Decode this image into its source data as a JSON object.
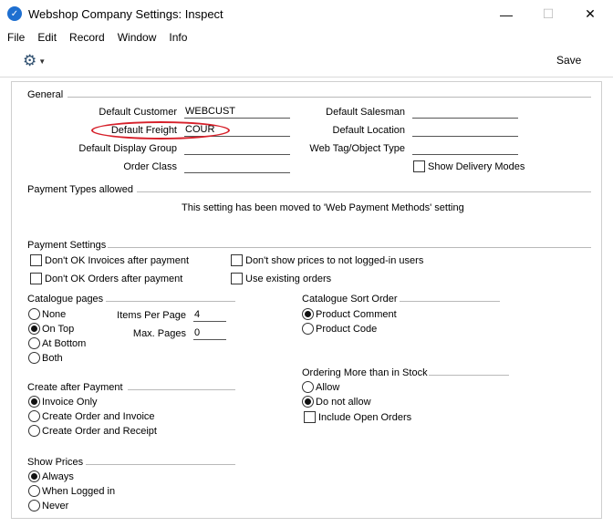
{
  "window": {
    "title": "Webshop Company Settings: Inspect",
    "app_icon_glyph": "✓"
  },
  "menu": [
    "File",
    "Edit",
    "Record",
    "Window",
    "Info"
  ],
  "toolbar": {
    "save_label": "Save",
    "gear_icon": "gear-icon"
  },
  "general": {
    "title": "General",
    "default_customer_label": "Default Customer",
    "default_customer_value": "WEBCUST",
    "default_freight_label": "Default Freight",
    "default_freight_value": "COUR",
    "default_display_group_label": "Default Display Group",
    "default_display_group_value": "",
    "order_class_label": "Order Class",
    "order_class_value": "",
    "default_salesman_label": "Default Salesman",
    "default_salesman_value": "",
    "default_location_label": "Default Location",
    "default_location_value": "",
    "web_tag_label": "Web Tag/Object Type",
    "web_tag_value": "",
    "show_delivery_modes_label": "Show Delivery Modes",
    "show_delivery_modes_checked": false
  },
  "payment_types": {
    "title": "Payment Types allowed",
    "message": "This setting has been moved to 'Web Payment Methods' setting"
  },
  "payment_settings": {
    "title": "Payment Settings",
    "dont_ok_invoices": "Don't OK Invoices after payment",
    "dont_ok_orders": "Don't OK Orders after payment",
    "dont_show_prices": "Don't show prices to not logged-in users",
    "use_existing_orders": "Use existing orders"
  },
  "catalogue_pages": {
    "title": "Catalogue pages",
    "options": [
      "None",
      "On Top",
      "At Bottom",
      "Both"
    ],
    "selected": "On Top",
    "items_per_page_label": "Items Per Page",
    "items_per_page_value": "4",
    "max_pages_label": "Max. Pages",
    "max_pages_value": "0"
  },
  "catalogue_sort": {
    "title": "Catalogue Sort Order",
    "options": [
      "Product Comment",
      "Product Code"
    ],
    "selected": "Product Comment"
  },
  "create_after_payment": {
    "title": "Create after Payment",
    "options": [
      "Invoice Only",
      "Create Order and Invoice",
      "Create Order and Receipt"
    ],
    "selected": "Invoice Only"
  },
  "ordering_more": {
    "title": "Ordering More than in Stock",
    "options": [
      "Allow",
      "Do not allow"
    ],
    "selected": "Do not allow",
    "include_open_orders_label": "Include Open Orders"
  },
  "show_prices": {
    "title": "Show Prices",
    "options": [
      "Always",
      "When Logged in",
      "Never"
    ],
    "selected": "Always"
  },
  "colors": {
    "highlight": "#d6202a",
    "app_icon": "#1e6fd0"
  }
}
